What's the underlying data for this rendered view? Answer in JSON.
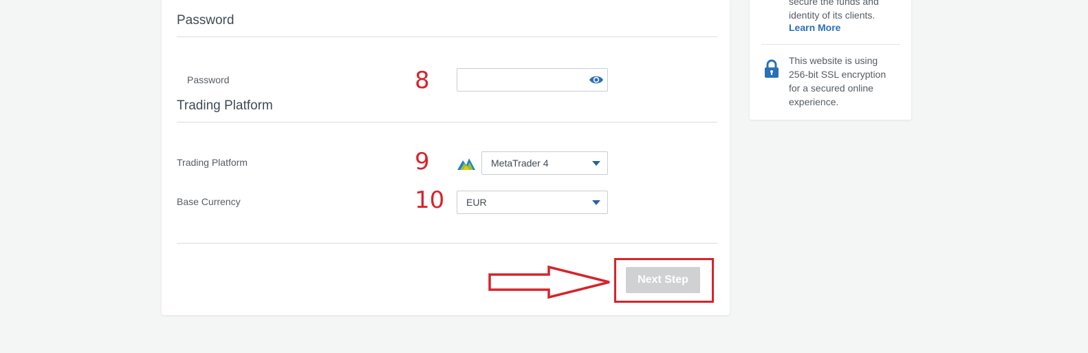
{
  "sections": {
    "password_title": "Password",
    "platform_title": "Trading Platform"
  },
  "fields": {
    "password_label": "Password",
    "password_value": "",
    "platform_label": "Trading Platform",
    "platform_value": "MetaTrader 4",
    "currency_label": "Base Currency",
    "currency_value": "EUR"
  },
  "annotations": {
    "step_password": "8",
    "step_platform": "9",
    "step_currency": "10"
  },
  "actions": {
    "next_label": "Next Step"
  },
  "side_panel": {
    "security_text": "secure the funds and identity of its clients.",
    "learn_more": "Learn More",
    "ssl_text": "This website is using 256-bit SSL encryption for a secured online experience."
  },
  "icons": {
    "eye": "eye-icon",
    "lock": "lock-icon",
    "caret": "chevron-down-icon",
    "platform_logo": "metatrader-logo"
  },
  "colors": {
    "accent": "#2a5fa8",
    "annotation_red": "#d8232a",
    "button_disabled": "#cfd1d3"
  }
}
